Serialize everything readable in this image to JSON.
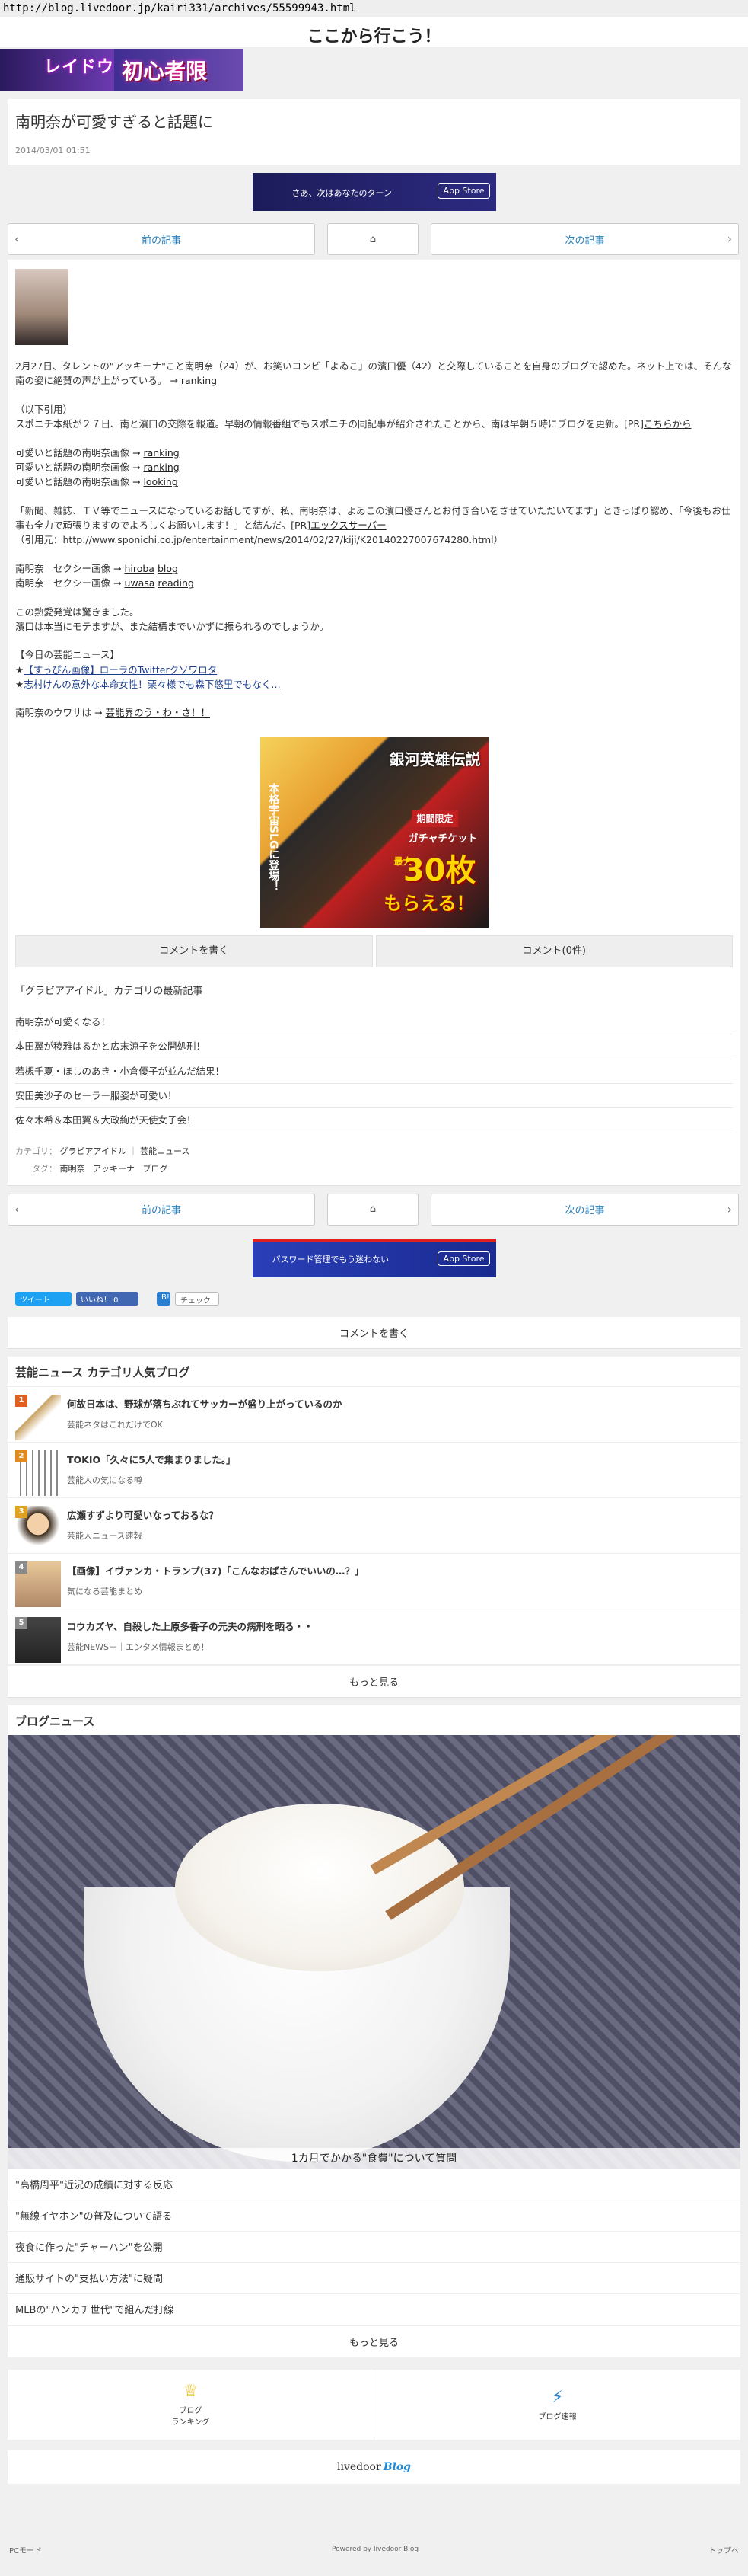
{
  "browser": {
    "url": "http://blog.livedoor.jp/kairi331/archives/55599943.html"
  },
  "site": {
    "title": "ここから行こう！"
  },
  "top_banner": {
    "logo": "レイドウ",
    "text": "初心者限"
  },
  "article": {
    "title": "南明奈が可愛すぎると話題に",
    "date": "2014/03/01 01:51"
  },
  "ad_top": {
    "text": "さあ、次はあなたのターン",
    "store": "App Store"
  },
  "pager": {
    "prev": "前の記事",
    "next": "次の記事"
  },
  "body": {
    "p1": "2月27日、タレントの\"アッキーナ\"こと南明奈（24）が、お笑いコンビ「よゐこ」の濱口優（42）と交際していることを自身のブログで認めた。ネット上では、そんな南の姿に絶賛の声が上がっている。 →",
    "p1_link": "ranking",
    "quote_head": "（以下引用）",
    "quote": "スポニチ本紙が２７日、南と濱口の交際を報道。早朝の情報番組でもスポニチの同記事が紹介されたことから、南は早朝５時にブログを更新。[PR]",
    "quote_link": "こちらから",
    "lines": [
      {
        "text": "可愛いと話題の南明奈画像 →",
        "link": "ranking"
      },
      {
        "text": "可愛いと話題の南明奈画像 →",
        "link": "ranking"
      },
      {
        "text": "可愛いと話題の南明奈画像 →",
        "link": "looking"
      }
    ],
    "p3": "「新聞、雑誌、ＴＶ等でニュースになっているお話しですが、私、南明奈は、よゐこの濱口優さんとお付き合いをさせていただいてます」ときっぱり認め、「今後もお仕事も全力で頑張りますのでよろしくお願いします！」と結んだ。[PR]",
    "p3_link": "エックスサーバー",
    "source": "（引用元：http://www.sponichi.co.jp/entertainment/news/2014/02/27/kiji/K20140227007674280.html）",
    "sexy": [
      {
        "text": "南明奈　セクシー画像 →",
        "link1": "hiroba",
        "link2": "blog"
      },
      {
        "text": "南明奈　セクシー画像 →",
        "link1": "uwasa",
        "link2": "reading"
      }
    ],
    "p5a": "この熱愛発覚は驚きました。",
    "p5b": "濱口は本当にモテますが、また結構までいかずに振られるのでしょうか。",
    "today_head": "【今日の芸能ニュース】",
    "today1_prefix": "★",
    "today1": "【すっぴん画像】ローラのTwitterクソワロタ",
    "today2_prefix": "★",
    "today2": "志村けんの意外な本命女性！栗々様でも森下悠里でもなく…",
    "rumor_text": "南明奈のウワサは →",
    "rumor_link": "芸能界のう・わ・さ！！"
  },
  "center_ad": {
    "title": "銀河英雄伝説",
    "line1": "本格宇宙SLGに登場！",
    "big": "30枚",
    "pre": "最大",
    "label": "期間限定",
    "sub": "ガチャチケット",
    "post": "もらえる！"
  },
  "comments": {
    "write": "コメントを書く",
    "count": "コメント(0件)"
  },
  "latest": {
    "head": "「グラビアアイドル」カテゴリの最新記事",
    "items": [
      "南明奈が可愛くなる！",
      "本田翼が稜雅はるかと広末涼子を公開処刑！",
      "若槻千夏・ほしのあき・小倉優子が並んだ結果！",
      "安田美沙子のセーラー服姿が可愛い！",
      "佐々木希＆本田翼＆大政絢が天使女子会！"
    ]
  },
  "tags": {
    "category_label": "カテゴリ：",
    "categories": [
      "グラビアアイドル",
      "芸能ニュース"
    ],
    "tag_label": "タグ：",
    "tags": [
      "南明奈",
      "アッキーナ",
      "ブログ"
    ]
  },
  "ad_bottom": {
    "text": "パスワード管理でもう迷わない",
    "store": "App Store"
  },
  "social": {
    "tweet": "ツイート",
    "like": "いいね！ 0",
    "hatena": "B!",
    "pocket": "チェック"
  },
  "write_comment": "コメントを書く",
  "popular": {
    "title": "芸能ニュース カテゴリ人気ブログ",
    "items": [
      {
        "num": "1",
        "title": "何故日本は、野球が落ちぶれてサッカーが盛り上がっているのか",
        "blog": "芸能ネタはこれだけでOK"
      },
      {
        "num": "2",
        "title": "TOKIO「久々に5人で集まりました。」",
        "blog": "芸能人の気になる噂"
      },
      {
        "num": "3",
        "title": "広瀬すずより可愛いなっておるな？",
        "blog": "芸能人ニュース速報"
      },
      {
        "num": "4",
        "title": "【画像】イヴァンカ・トランプ(37)「こんなおばさんでいいの…？」",
        "blog": "気になる芸能まとめ"
      },
      {
        "num": "5",
        "title": "コウカズヤ、自殺した上原多香子の元夫の病刑を晒る・・",
        "blog": "芸能NEWS＋｜エンタメ情報まとめ！"
      }
    ],
    "more": "もっと見る"
  },
  "blog_news": {
    "title": "ブログニュース",
    "caption": "1カ月でかかる\"食費\"について質問",
    "items": [
      "\"高橋周平\"近況の成績に対する反応",
      "\"無線イヤホン\"の普及について語る",
      "夜食に作った\"チャーハン\"を公開",
      "通販サイトの\"支払い方法\"に疑問",
      "MLBの\"ハンカチ世代\"で組んだ打線"
    ],
    "more": "もっと見る"
  },
  "footer_nav": {
    "ranking_line1": "ブログ",
    "ranking_line2": "ランキング",
    "quick": "ブログ速報"
  },
  "livedoor": {
    "brand": "livedoor",
    "blog": "Blog"
  },
  "bottom": {
    "pc": "PCモード",
    "powered": "Powered by livedoor Blog",
    "top": "トップへ"
  }
}
